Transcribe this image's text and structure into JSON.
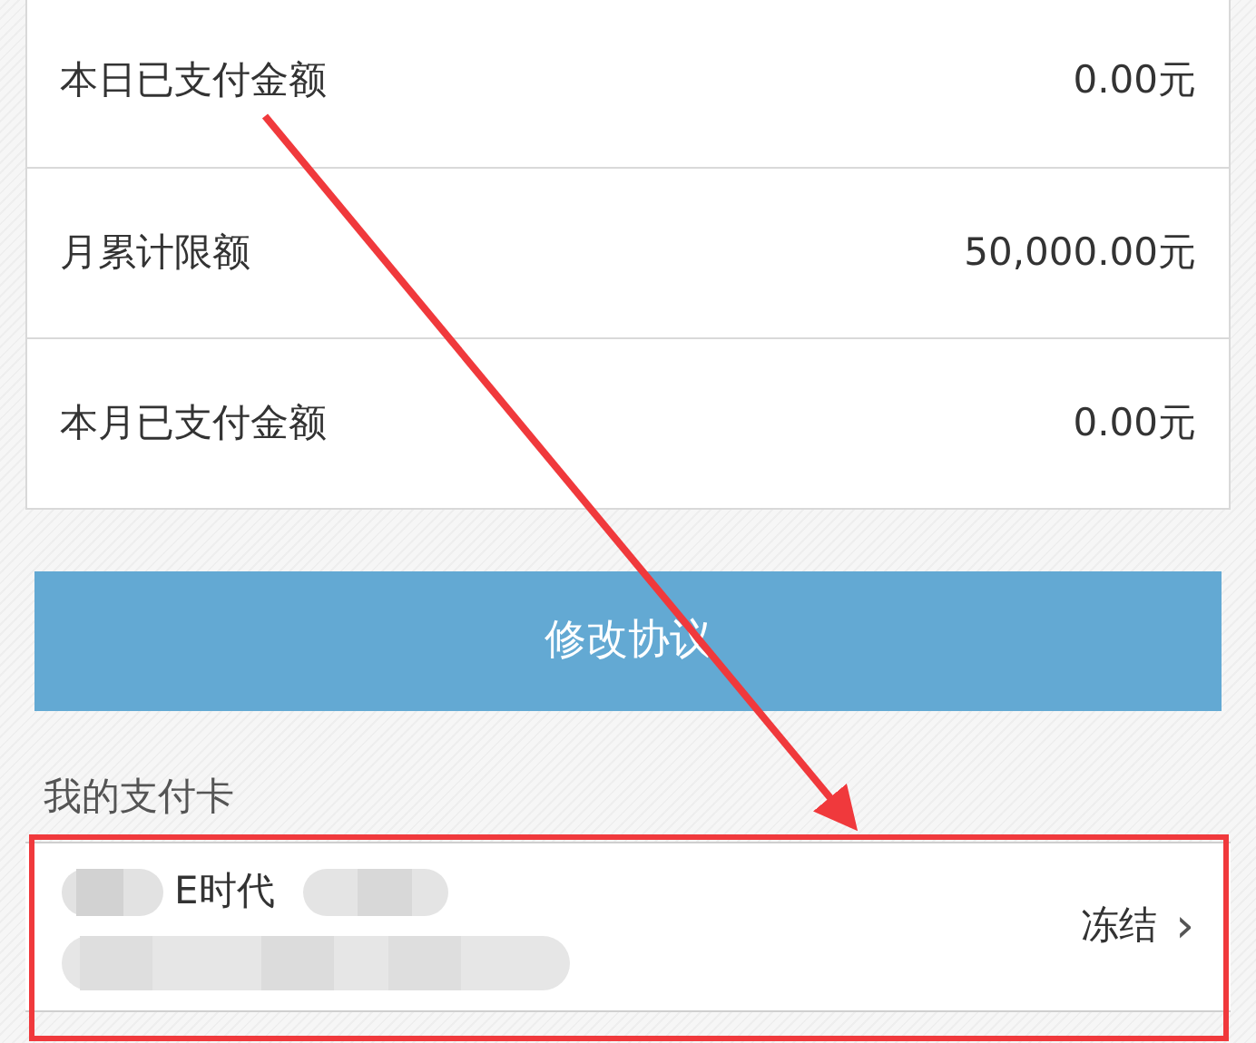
{
  "limits": [
    {
      "label": "本日已支付金额",
      "value": "0.00元"
    },
    {
      "label": "月累计限额",
      "value": "50,000.00元"
    },
    {
      "label": "本月已支付金额",
      "value": "0.00元"
    }
  ],
  "modify_button": "修改协议",
  "cards_heading": "我的支付卡",
  "cards": [
    {
      "name": "E时代",
      "status": "冻结",
      "chevron": "›"
    }
  ]
}
